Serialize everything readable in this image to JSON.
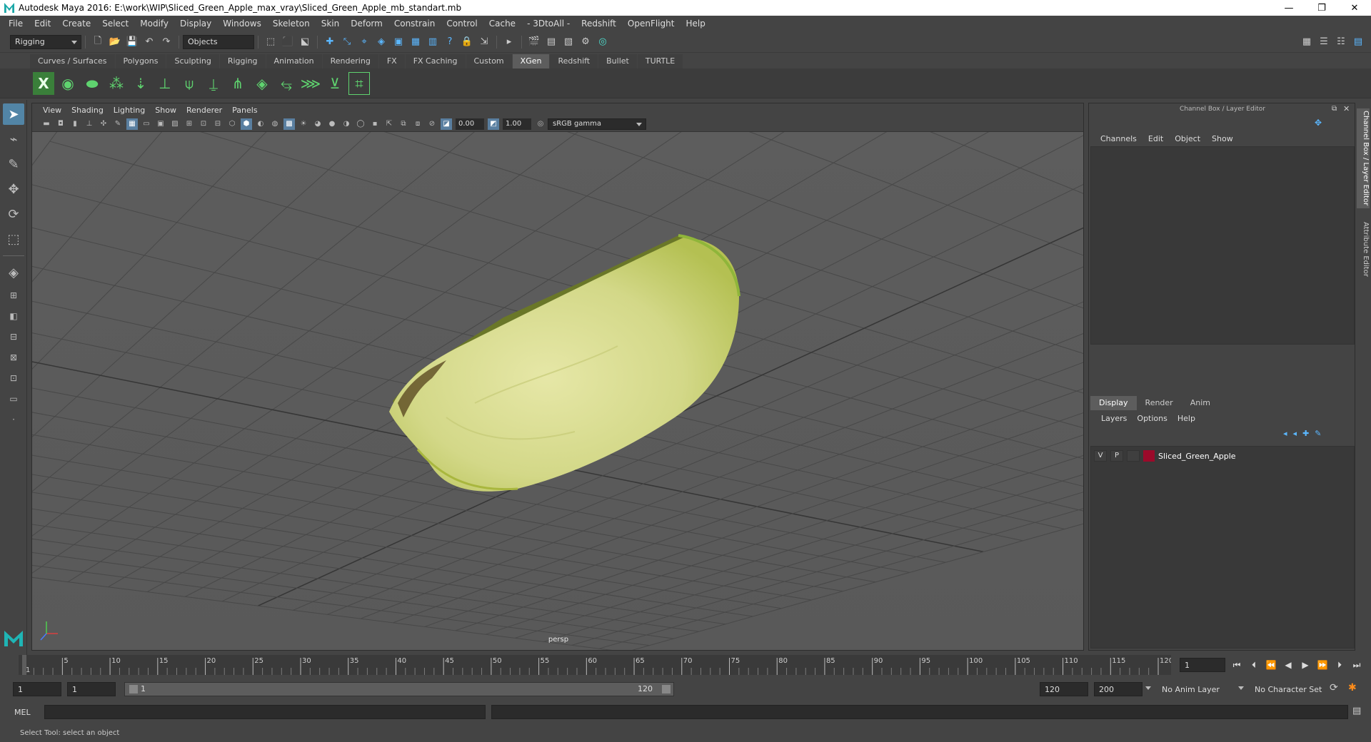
{
  "window": {
    "title": "Autodesk Maya 2016: E:\\work\\WIP\\Sliced_Green_Apple_max_vray\\Sliced_Green_Apple_mb_standart.mb",
    "minimize": "—",
    "restore": "❐",
    "close": "✕"
  },
  "menus": [
    "File",
    "Edit",
    "Create",
    "Select",
    "Modify",
    "Display",
    "Windows",
    "Skeleton",
    "Skin",
    "Deform",
    "Constrain",
    "Control",
    "Cache",
    "- 3DtoAll -",
    "Redshift",
    "OpenFlight",
    "Help"
  ],
  "statusline": {
    "mode": "Rigging",
    "selection_mode": "Objects"
  },
  "shelf_tabs": [
    "Curves / Surfaces",
    "Polygons",
    "Sculpting",
    "Rigging",
    "Animation",
    "Rendering",
    "FX",
    "FX Caching",
    "Custom",
    "XGen",
    "Redshift",
    "Bullet",
    "TURTLE"
  ],
  "shelf_active": "XGen",
  "viewport": {
    "menus": [
      "View",
      "Shading",
      "Lighting",
      "Show",
      "Renderer",
      "Panels"
    ],
    "exposure": "0.00",
    "gamma": "1.00",
    "color_space": "sRGB gamma",
    "camera": "persp"
  },
  "channel_box": {
    "title": "Channel Box / Layer Editor",
    "menus": [
      "Channels",
      "Edit",
      "Object",
      "Show"
    ]
  },
  "layer_editor": {
    "tabs": [
      "Display",
      "Render",
      "Anim"
    ],
    "active_tab": "Display",
    "menus": [
      "Layers",
      "Options",
      "Help"
    ],
    "layers": [
      {
        "visible": "V",
        "playback": "P",
        "name": "Sliced_Green_Apple",
        "color": "#9b0a2a"
      }
    ]
  },
  "side_tabs": [
    "Channel Box / Layer Editor",
    "Attribute Editor"
  ],
  "timeline": {
    "ticks": [
      1,
      5,
      10,
      15,
      20,
      25,
      30,
      35,
      40,
      45,
      50,
      55,
      60,
      65,
      70,
      75,
      80,
      85,
      90,
      95,
      100,
      105,
      110,
      115,
      120
    ],
    "min": 1,
    "max": 120,
    "current_frame": "1"
  },
  "range": {
    "start": "1",
    "playback_start": "1",
    "slider_start": "1",
    "slider_end": "120",
    "playback_end": "120",
    "end": "200",
    "anim_layer": "No Anim Layer",
    "character_set": "No Character Set"
  },
  "command_line": {
    "label": "MEL"
  },
  "help_line": "Select Tool: select an object",
  "colors": {
    "accent": "#5285a6",
    "apple_flesh": "#d8db93",
    "apple_skin": "#9bb13a",
    "grid": "#484848"
  }
}
